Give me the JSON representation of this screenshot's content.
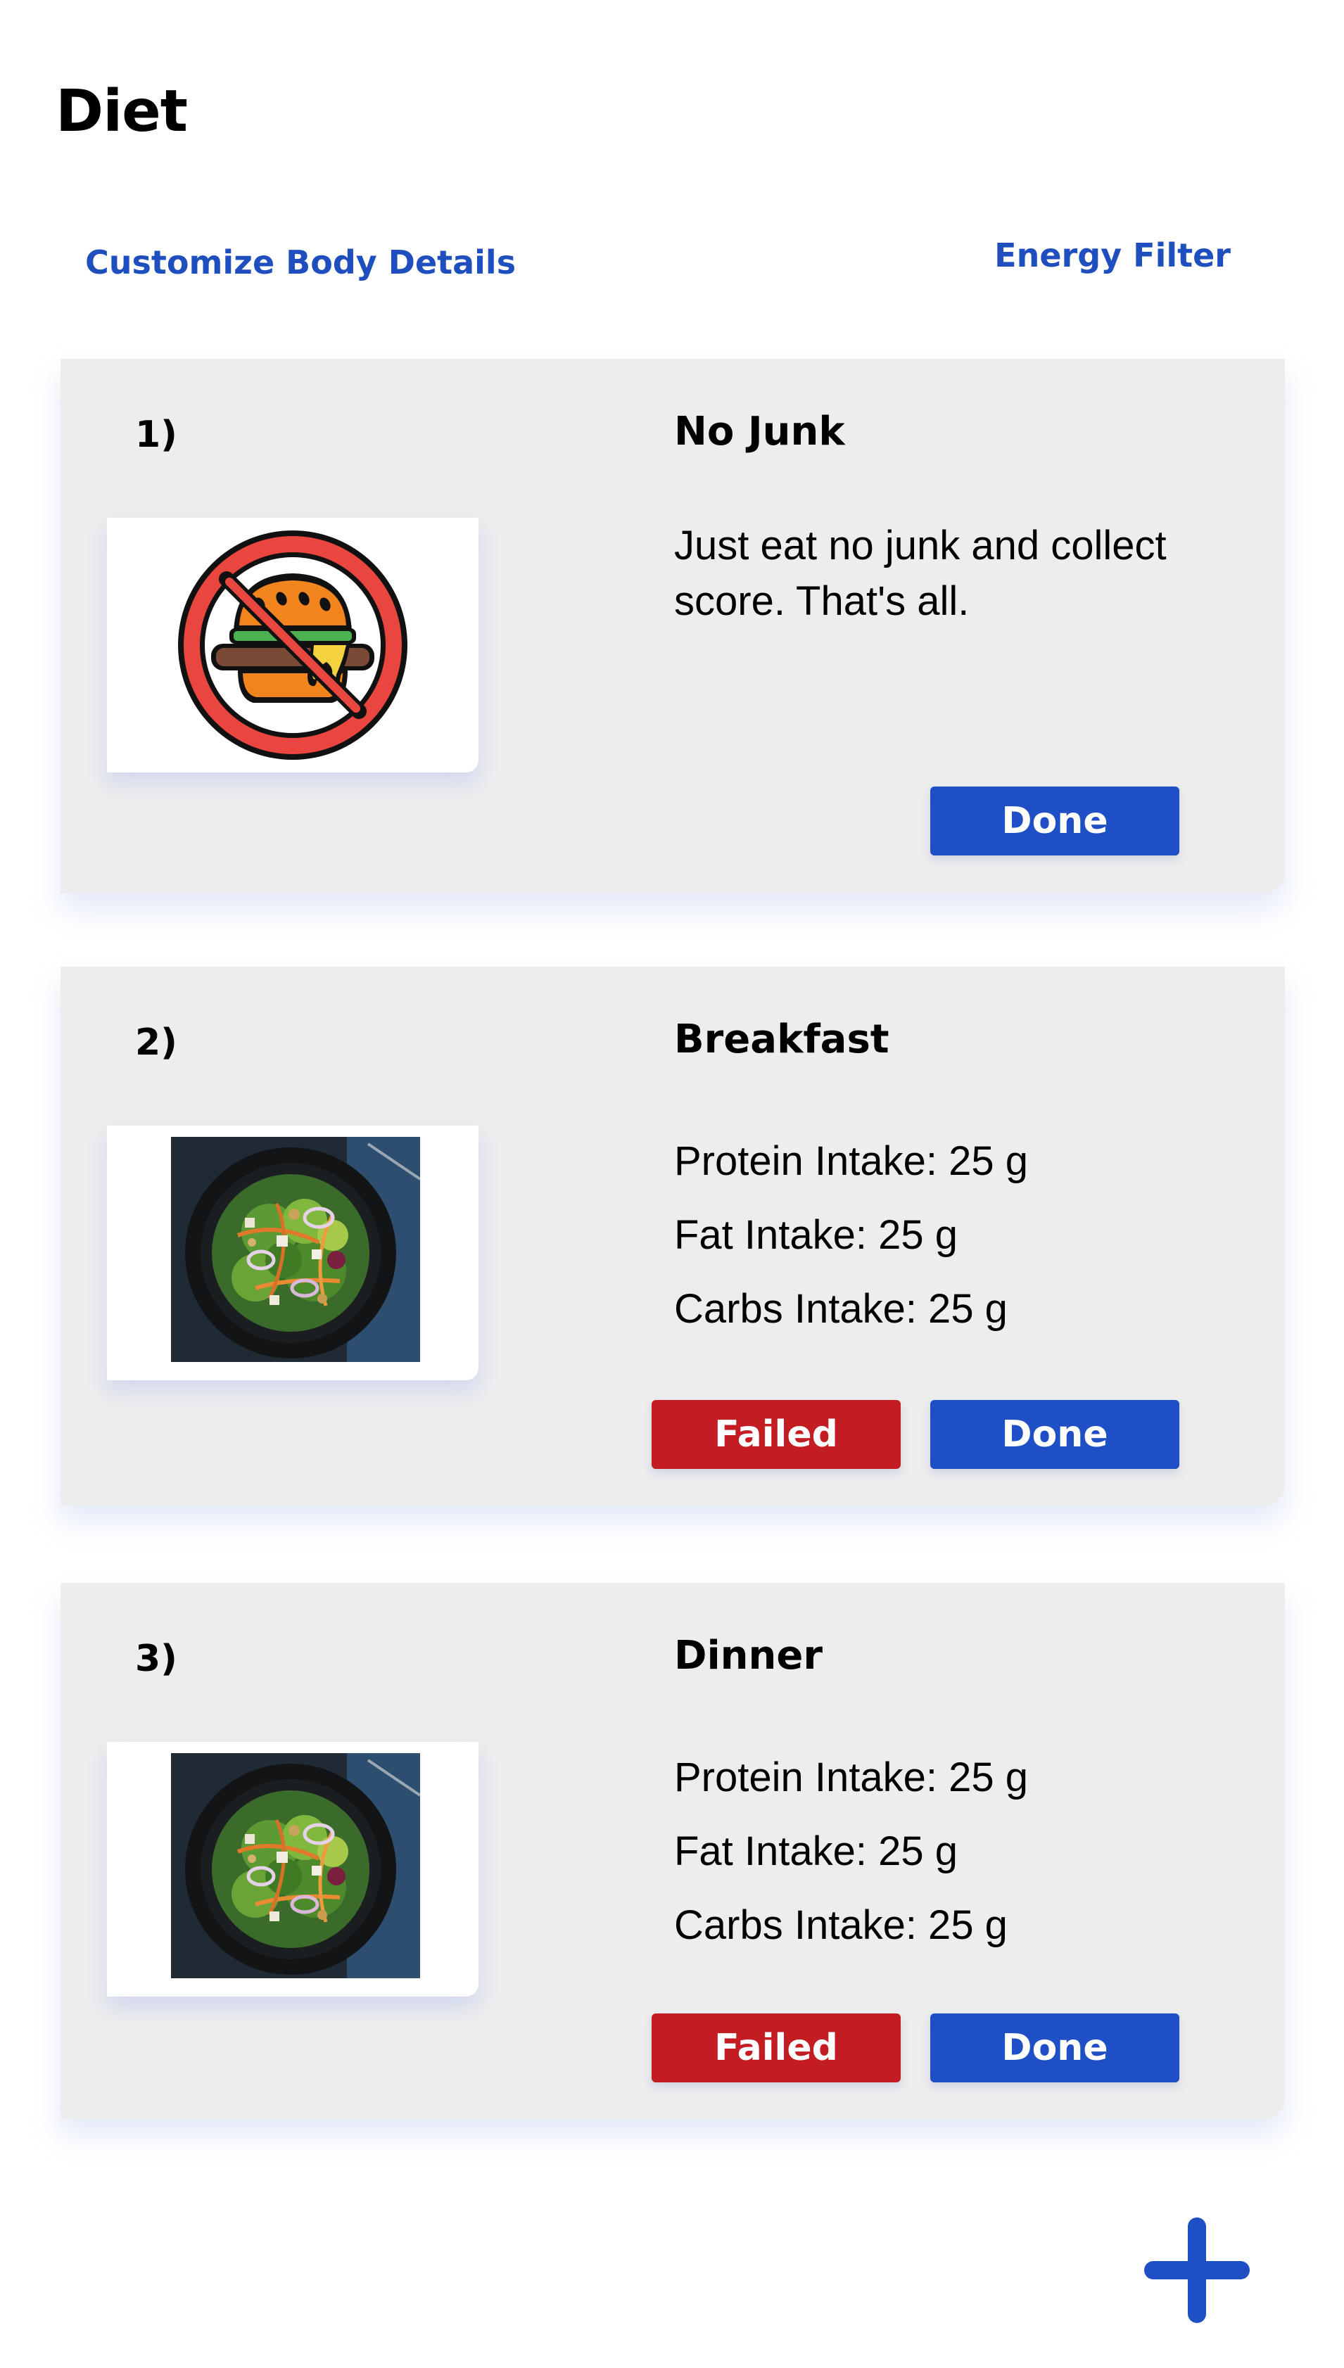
{
  "header": {
    "title": "Diet"
  },
  "links": {
    "customize": "Customize Body Details",
    "energy_filter": "Energy Filter"
  },
  "cards": [
    {
      "number": "1)",
      "title": "No Junk",
      "description": "Just eat no junk and collect score. That's all.",
      "image_icon": "no-junk-food-icon",
      "done_label": "Done"
    },
    {
      "number": "2)",
      "title": "Breakfast",
      "intake": [
        "Protein Intake: 25 g",
        "Fat Intake: 25 g",
        "Carbs Intake: 25 g"
      ],
      "image_icon": "salad-image",
      "failed_label": "Failed",
      "done_label": "Done"
    },
    {
      "number": "3)",
      "title": "Dinner",
      "intake": [
        "Protein Intake: 25 g",
        "Fat Intake: 25 g",
        "Carbs Intake: 25 g"
      ],
      "image_icon": "salad-image",
      "failed_label": "Failed",
      "done_label": "Done"
    }
  ],
  "fab": {
    "icon": "plus-icon"
  },
  "colors": {
    "accent": "#1f4fc4",
    "link": "#1f4fbf",
    "danger": "#c31d23",
    "card_bg": "#ededee"
  }
}
